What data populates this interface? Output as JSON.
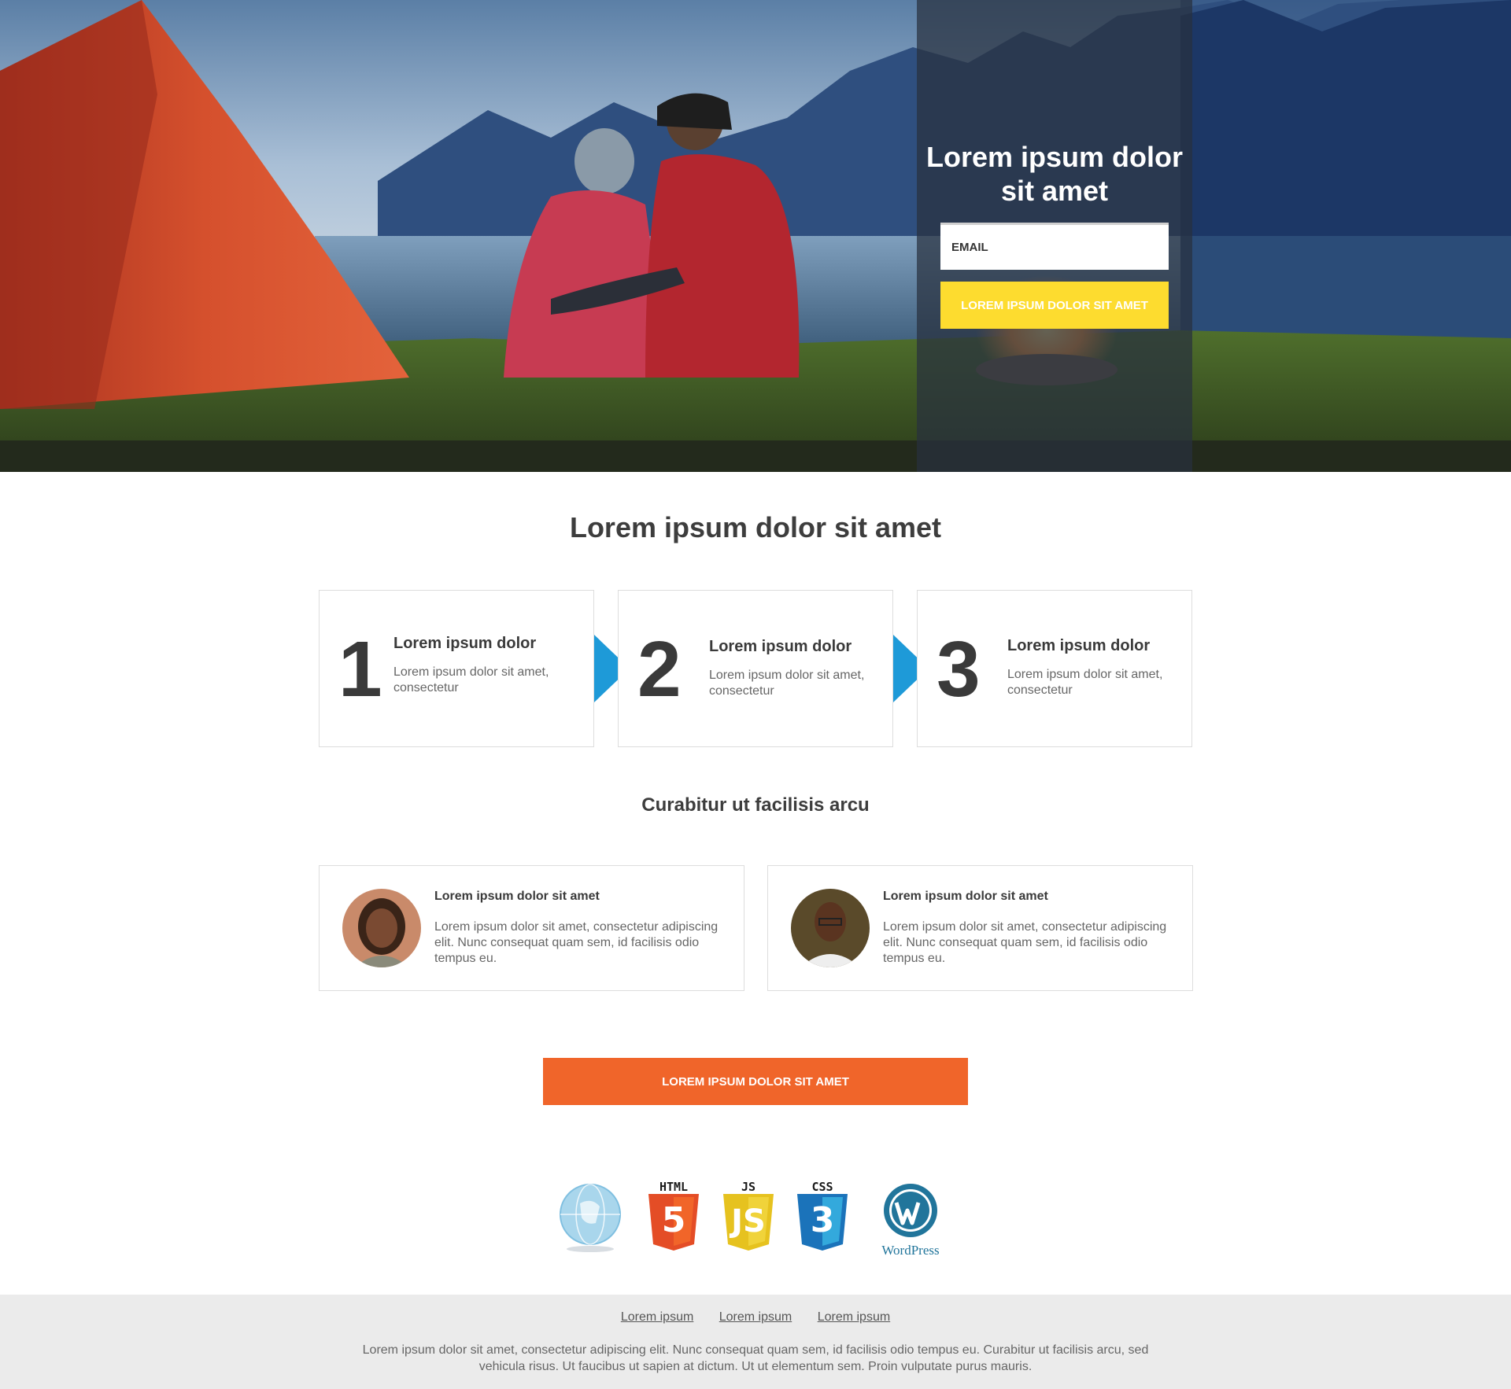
{
  "colors": {
    "accent_yellow": "#fddc2f",
    "accent_orange": "#f0652a",
    "arrow_blue": "#1e9ad8",
    "footer_bg": "#ebebeb"
  },
  "hero": {
    "title": "Lorem ipsum dolor sit amet",
    "email_placeholder": "EMAIL",
    "submit_label": "LOREM IPSUM DOLOR SIT AMET"
  },
  "steps_section": {
    "title": "Lorem ipsum dolor sit amet",
    "steps": [
      {
        "number": "1",
        "heading": "Lorem ipsum dolor",
        "text": "Lorem ipsum dolor sit amet, consectetur"
      },
      {
        "number": "2",
        "heading": "Lorem ipsum dolor",
        "text": "Lorem ipsum dolor sit amet, consectetur"
      },
      {
        "number": "3",
        "heading": "Lorem ipsum dolor",
        "text": "Lorem ipsum dolor sit amet, consectetur"
      }
    ]
  },
  "testimonials_section": {
    "title": "Curabitur ut facilisis arcu",
    "items": [
      {
        "name": "Lorem ipsum dolor sit amet",
        "text": "Lorem ipsum dolor sit amet, consectetur adipiscing elit. Nunc consequat quam sem, id facilisis odio tempus eu."
      },
      {
        "name": "Lorem ipsum dolor sit amet",
        "text": "Lorem ipsum dolor sit amet, consectetur adipiscing elit. Nunc consequat quam sem, id facilisis odio tempus eu."
      }
    ]
  },
  "cta": {
    "label": "LOREM IPSUM DOLOR SIT AMET"
  },
  "logos": {
    "html_label": "HTML",
    "js_label": "JS",
    "css_label": "CSS",
    "html_digit": "5",
    "css_digit": "3",
    "wordpress_label": "WordPress",
    "icons": [
      "globe-icon",
      "html5-icon",
      "js-icon",
      "css3-icon",
      "wordpress-icon"
    ]
  },
  "footer": {
    "links": [
      "Lorem ipsum",
      "Lorem ipsum",
      "Lorem ipsum"
    ],
    "text": "Lorem ipsum dolor sit amet, consectetur adipiscing elit. Nunc consequat quam sem, id facilisis odio tempus eu. Curabitur ut facilisis arcu, sed vehicula risus. Ut faucibus ut sapien at dictum. Ut ut elementum sem. Proin vulputate purus mauris."
  }
}
